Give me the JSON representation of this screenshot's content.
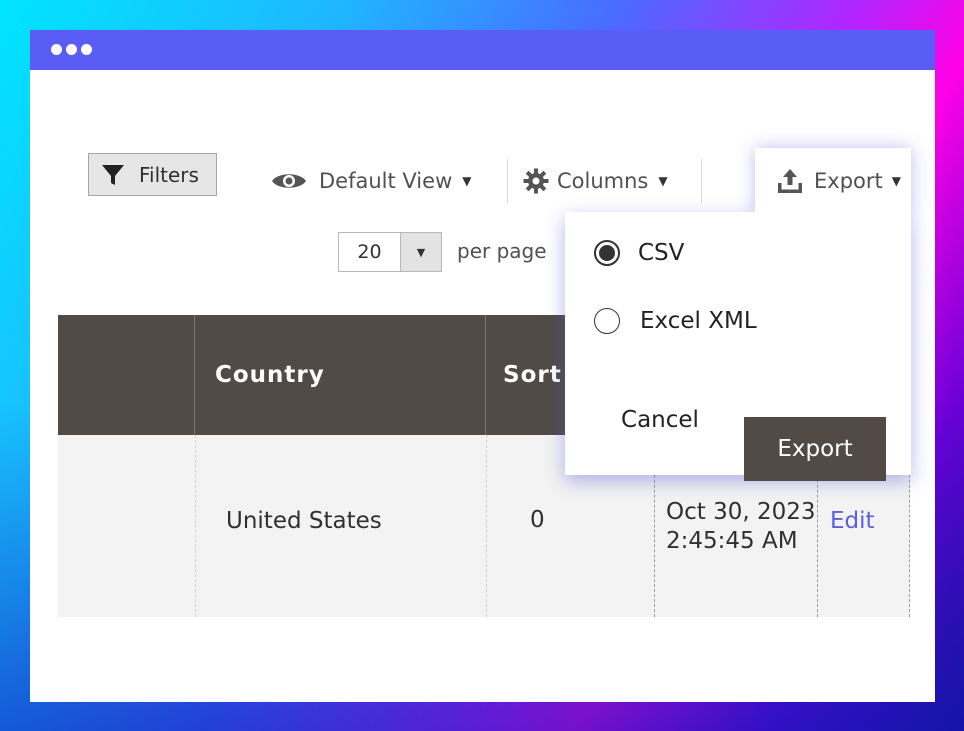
{
  "toolbar": {
    "filters_label": "Filters",
    "default_view_label": "Default View",
    "columns_label": "Columns",
    "export_label": "Export"
  },
  "pager": {
    "value": "20",
    "per_page_label": "per page"
  },
  "table": {
    "headers": [
      "",
      "Country",
      "Sort",
      "",
      ""
    ],
    "rows": [
      {
        "country": "United States",
        "sort": "0",
        "date": "Oct 30, 2023",
        "time": "2:45:45 AM",
        "action": "Edit"
      }
    ]
  },
  "export_dropdown": {
    "options": [
      {
        "label": "CSV",
        "selected": true
      },
      {
        "label": "Excel XML",
        "selected": false
      }
    ],
    "cancel_label": "Cancel",
    "export_label": "Export"
  },
  "colors": {
    "titlebar": "#5a5cf6",
    "header_bg": "#514a45",
    "link": "#5b5fe0"
  }
}
